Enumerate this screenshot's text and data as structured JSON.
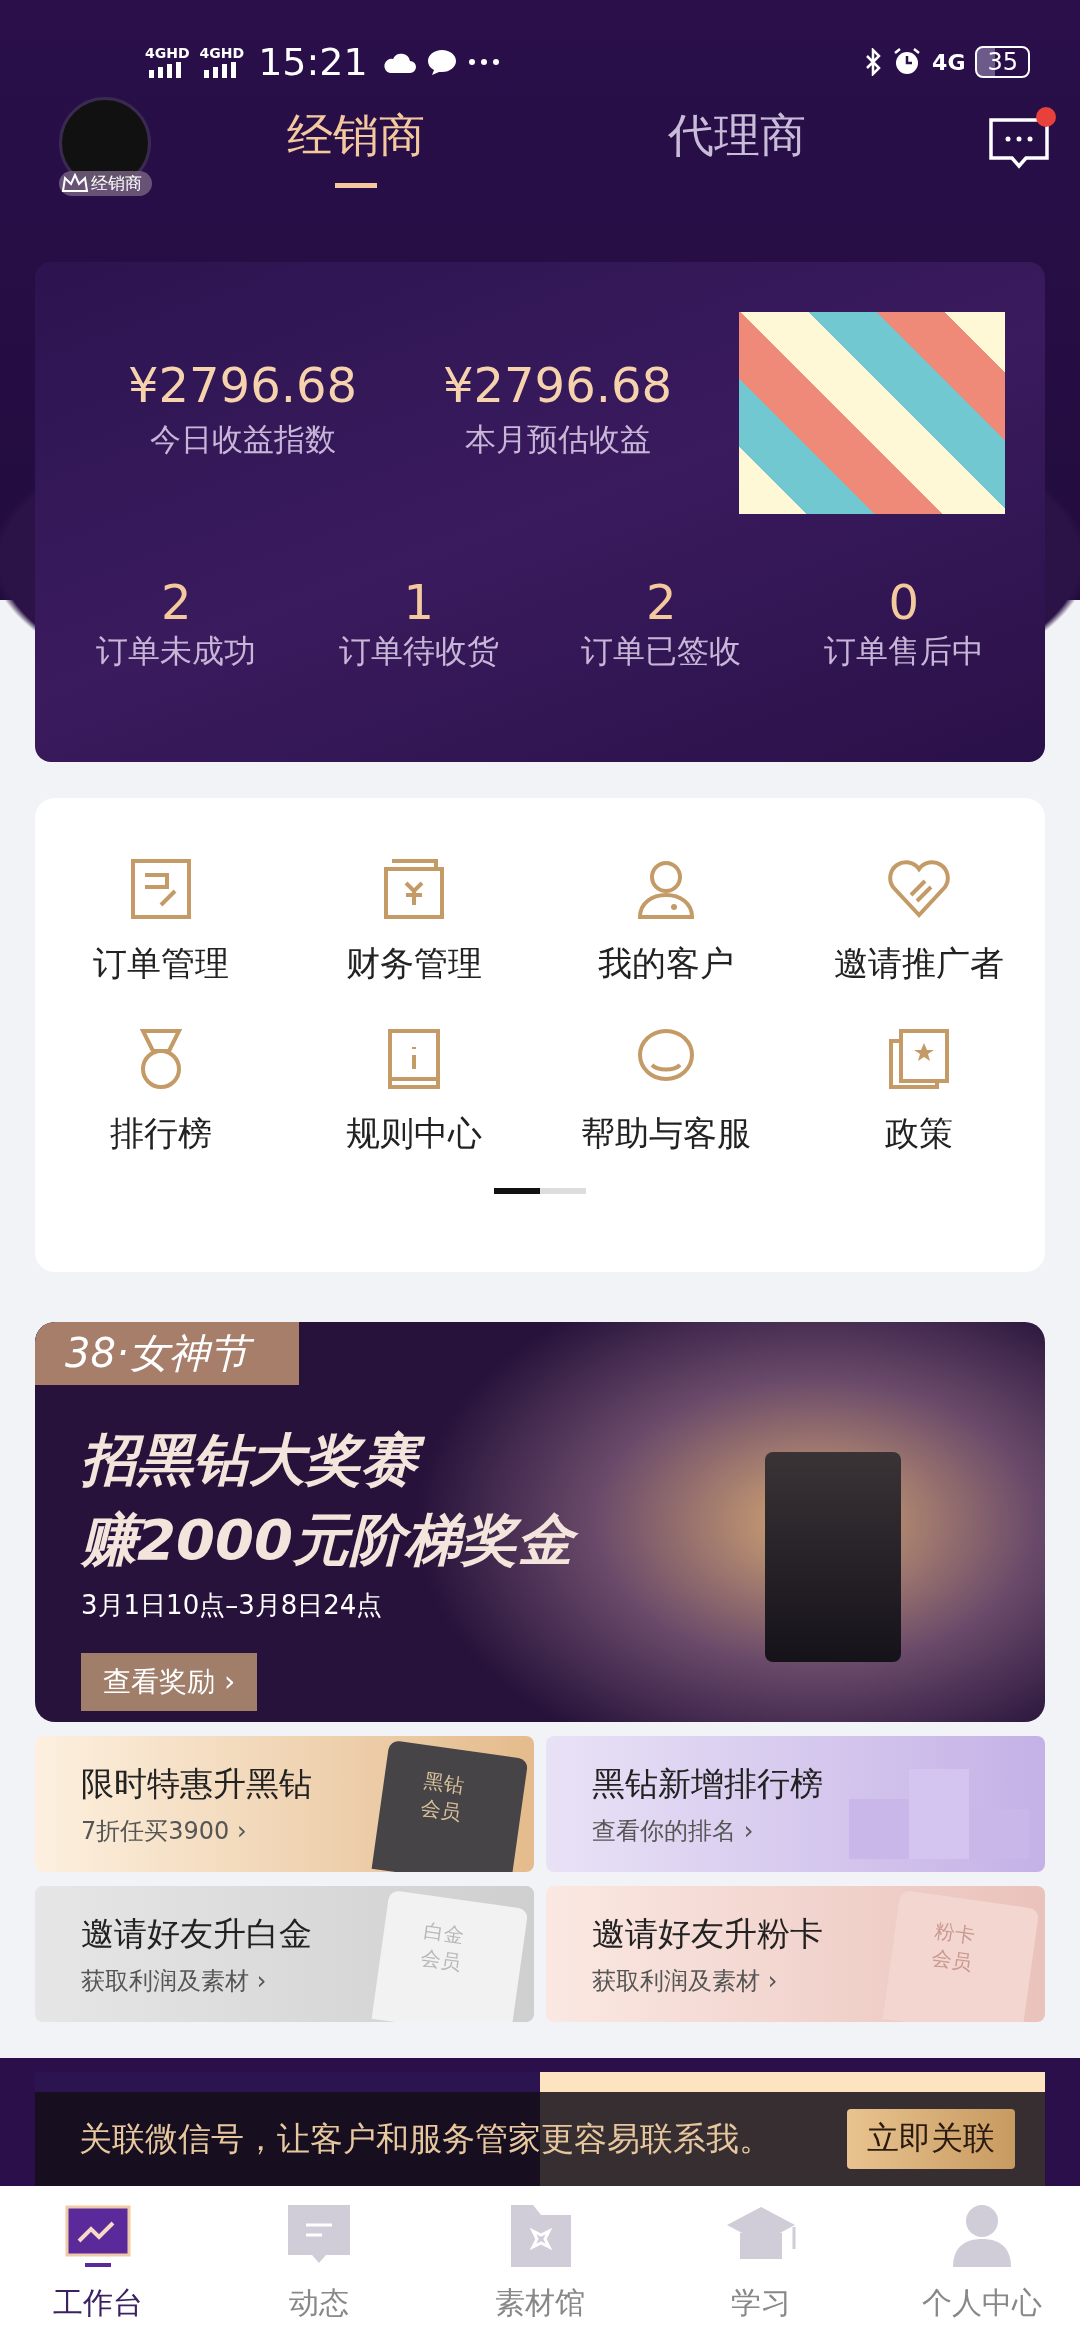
{
  "status_bar": {
    "network_1": "4GHD",
    "network_2": "4GHD",
    "time": "15:21",
    "network_3": "4G",
    "battery": "35"
  },
  "header": {
    "avatar_badge": "经销商",
    "tabs": [
      {
        "label": "经销商",
        "selected": true
      },
      {
        "label": "代理商",
        "selected": false
      }
    ],
    "message_unread": true
  },
  "summary": {
    "earnings": [
      {
        "amount": "¥2796.68",
        "label": "今日收益指数"
      },
      {
        "amount": "¥2796.68",
        "label": "本月预估收益"
      }
    ],
    "orders": [
      {
        "count": "2",
        "label": "订单未成功"
      },
      {
        "count": "1",
        "label": "订单待收货"
      },
      {
        "count": "2",
        "label": "订单已签收"
      },
      {
        "count": "0",
        "label": "订单售后中"
      }
    ]
  },
  "shortcuts": [
    {
      "label": "订单管理"
    },
    {
      "label": "财务管理"
    },
    {
      "label": "我的客户"
    },
    {
      "label": "邀请推广者"
    },
    {
      "label": "排行榜"
    },
    {
      "label": "规则中心"
    },
    {
      "label": "帮助与客服"
    },
    {
      "label": "政策"
    }
  ],
  "banner": {
    "tag": "38·女神节",
    "title": "招黑钻大奖赛",
    "subtitle": "赚2000元阶梯奖金",
    "dates": "3月1日10点–3月8日24点",
    "button": "查看奖励 ›"
  },
  "promos": [
    {
      "title": "限时特惠升黑钻",
      "link": "7折任买3900 ›",
      "kind": "gold",
      "card": "黑钻会员"
    },
    {
      "title": "黑钻新增排行榜",
      "link": "查看你的排名 ›",
      "kind": "lilac"
    },
    {
      "title": "邀请好友升白金",
      "link": "获取利润及素材 ›",
      "kind": "silver",
      "card": "白金会员"
    },
    {
      "title": "邀请好友升粉卡",
      "link": "获取利润及素材 ›",
      "kind": "pink",
      "card": "粉卡会员"
    }
  ],
  "notice": {
    "text": "关联微信号，让客户和服务管家更容易联系我。",
    "button": "立即关联"
  },
  "tab_bar": [
    {
      "label": "工作台",
      "selected": true
    },
    {
      "label": "动态",
      "selected": false
    },
    {
      "label": "素材馆",
      "selected": false
    },
    {
      "label": "学习",
      "selected": false
    },
    {
      "label": "个人中心",
      "selected": false
    }
  ]
}
